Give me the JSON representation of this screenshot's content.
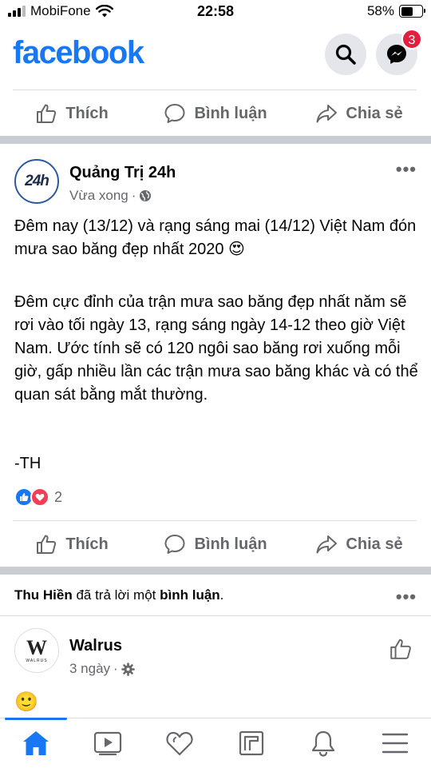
{
  "status_bar": {
    "carrier": "MobiFone",
    "time": "22:58",
    "battery_percent": "58%",
    "battery_level": 0.58
  },
  "header": {
    "logo": "facebook",
    "messenger_badge": "3"
  },
  "actions": {
    "like": "Thích",
    "comment": "Bình luận",
    "share": "Chia sẻ"
  },
  "post": {
    "page_name": "Quảng Trị 24h",
    "avatar_text": "24h",
    "time": "Vừa xong",
    "paragraph1": "Đêm nay (13/12) và rạng sáng mai (14/12) Việt Nam đón mưa sao băng đẹp nhất 2020 😍",
    "paragraph2": "Đêm cực đỉnh của trận mưa sao băng đẹp nhất năm sẽ rơi vào tối ngày 13, rạng sáng ngày 14-12 theo giờ Việt Nam. Ước tính sẽ có 120 ngôi sao băng rơi xuống mỗi giờ, gấp nhiều lần các trận mưa sao băng khác và có thể quan sát bằng mắt thường.",
    "signature": "-TH",
    "reaction_count": "2"
  },
  "notification": {
    "user": "Thu Hiền",
    "middle": " đã trả lời một ",
    "target": "bình luận",
    "end": "."
  },
  "next_post": {
    "page_name": "Walrus",
    "avatar_letter": "W",
    "avatar_caption": "WALRUS",
    "time": "3 ngày",
    "emoji": "🙂"
  },
  "colors": {
    "brand": "#1877f2",
    "badge": "#e41e3f",
    "love": "#f33e58",
    "muted": "#65676b"
  }
}
